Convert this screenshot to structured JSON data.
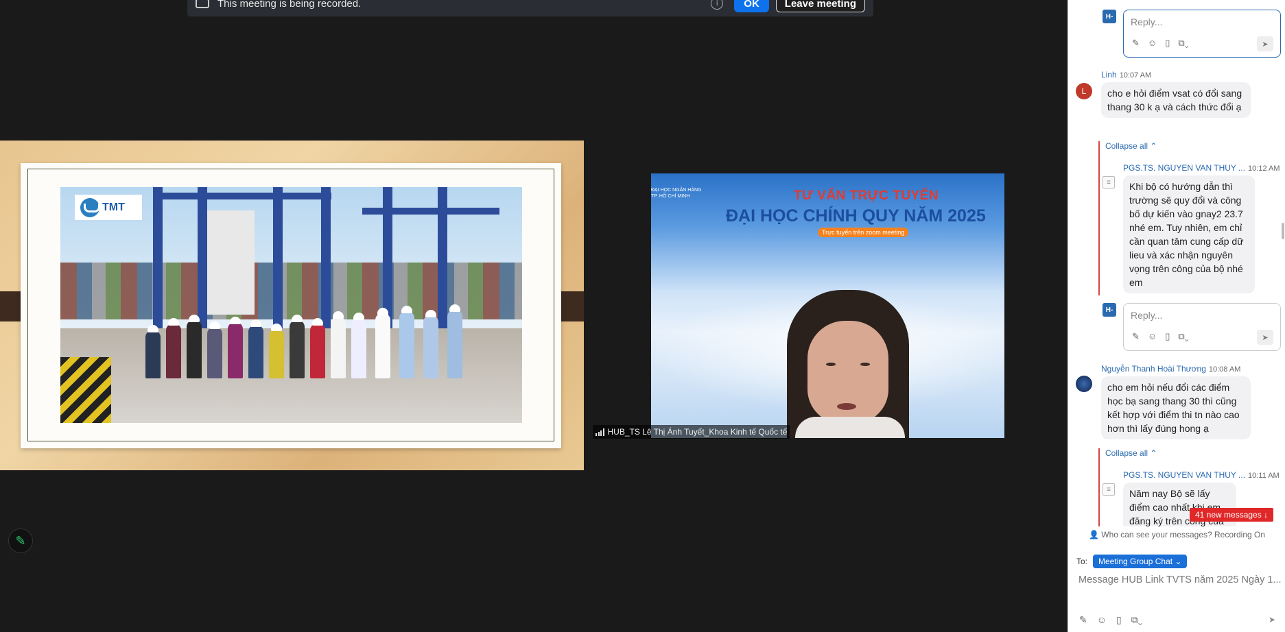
{
  "banner": {
    "text": "This meeting is being recorded.",
    "info_icon": "info-icon",
    "ok_label": "OK",
    "leave_label": "Leave meeting"
  },
  "slide": {
    "logo_text": "TMT"
  },
  "video": {
    "university": "ĐẠI HỌC NGÂN HÀNG\nTP. HỒ CHÍ MINH",
    "headline1": "TƯ VẤN TRỰC TUYẾN",
    "headline2": "ĐẠI HỌC CHÍNH QUY NĂM 2025",
    "pill": "Trực tuyến trên zoom meeting",
    "participant_name": "HUB_TS Lê Thị Ánh Tuyết_Khoa Kinh tế Quốc tế"
  },
  "chat": {
    "reply_placeholder": "Reply...",
    "reply_avatar": "H-",
    "collapse_label": "Collapse all ⌃",
    "messages": [
      {
        "sender": "Linh",
        "time": "10:07 AM",
        "avatar": "L",
        "text": "cho e hỏi điểm vsat có đổi sang thang 30 k ạ và cách thức đổi ạ"
      },
      {
        "sender": "PGS.TS. NGUYEN VAN THUY ...",
        "time": "10:12 AM",
        "text": "Khi bộ có hướng dẫn thì trường sẽ quy đổi và công bố dự kiến vào gnay2 23.7 nhé em. Tuy nhiên, em chỉ cần quan tâm cung cấp dữ lieu và xác nhận nguyên vọng trên công của bộ nhé em"
      },
      {
        "sender": "Nguyễn Thanh Hoài Thương",
        "time": "10:08 AM",
        "text": "cho em hỏi nếu đổi các điểm học bạ sang thang 30 thì cũng kết hợp với điểm thi tn nào cao hơn thì lấy đúng hong ạ"
      },
      {
        "sender": "PGS.TS. NGUYEN VAN THUY ...",
        "time": "10:11 AM",
        "text": "Năm nay Bộ sẽ lấy điểm cao nhất khi em đăng ký trên cổng của Bộ nhé."
      }
    ],
    "new_messages": "41 new messages ↓",
    "who_can_see": "Who can see your messages? Recording On",
    "to_label": "To:",
    "to_recipient": "Meeting Group Chat ⌄",
    "input_placeholder": "Message HUB Link TVTS năm 2025 Ngày 1..."
  },
  "colors": {
    "accent": "#0e72ed",
    "link": "#2a6ab0",
    "alert": "#e02828"
  }
}
